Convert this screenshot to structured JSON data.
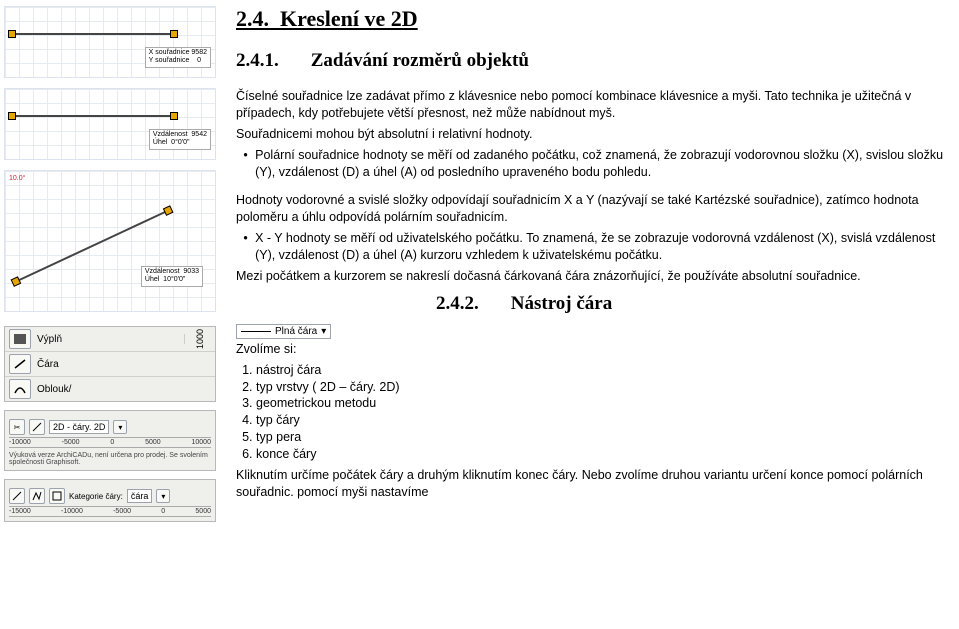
{
  "heading": {
    "num": "2.4.",
    "title": "Kreslení ve 2D"
  },
  "sub1": {
    "num": "2.4.1.",
    "title": "Zadávání rozměrů objektů"
  },
  "para_intro": "Číselné souřadnice lze zadávat přímo z klávesnice nebo pomocí kombinace klávesnice a myši. Tato technika je užitečná v případech, kdy potřebujete větší přesnost, než může nabídnout myš.",
  "para_types": "Souřadnicemi mohou být absolutní i relativní hodnoty.",
  "bullet_polar": "Polární souřadnice hodnoty se měří od zadaného počátku, což znamená, že zobrazují vodorovnou složku (X), svislou složku (Y), vzdálenost (D) a úhel (A) od posledního upraveného bodu pohledu.",
  "para_cart": "Hodnoty vodorovné a svislé složky odpovídají souřadnicím X a Y (nazývají se také Kartézské souřadnice), zatímco hodnota poloměru a úhlu odpovídá polárním souřadnicím.",
  "bullet_xy": "X - Y hodnoty se měří od uživatelského počátku. To znamená, že se zobrazuje vodorovná vzdálenost (X), svislá vzdálenost (Y), vzdálenost (D) a úhel (A) kurzoru vzhledem k uživatelskému počátku.",
  "para_dash": "Mezi počátkem a kurzorem se nakreslí dočasná čárkovaná čára znázorňující, že používáte absolutní souřadnice.",
  "sub2": {
    "num": "2.4.2.",
    "title": "Nástroj čára"
  },
  "zvolime": "Zvolíme si:",
  "steps": [
    "nástroj čára",
    "typ vrstvy ( 2D – čáry. 2D)",
    "geometrickou metodu",
    "typ čáry",
    "typ pera",
    "konce čáry"
  ],
  "final": "Kliknutím určíme počátek čáry a druhým kliknutím konec čáry. Nebo zvolíme druhou variantu určení konce pomocí polárních souřadnic. pomocí myši nastavíme",
  "left": {
    "tip1": "X souřadnice 9582\nY souřadnice    0",
    "tip2": "Vzdálenost  9542\nÚhel  0°0'0\"",
    "tip3": "Vzdálenost  9033\nÚhel  10°0'0\"",
    "angle_lbl": "10.0°",
    "tool_vypln": "Výplň",
    "tool_cara": "Čára",
    "tool_oblouk": "Oblouk/",
    "dim_1000": "1000",
    "layer_label": "2D - čáry. 2D",
    "linetype": "Plná čára",
    "ruler_vals": [
      "-10000",
      "-5000",
      "0",
      "5000",
      "10000"
    ],
    "disclaimer": "Výuková verze ArchiCADu, není určena pro prodej. Se svolením společnosti Graphisoft.",
    "kat_label": "Kategorie čáry:",
    "kat_value": "čára",
    "ruler2_vals": [
      "-15000",
      "-10000",
      "-5000",
      "0",
      "5000"
    ]
  }
}
